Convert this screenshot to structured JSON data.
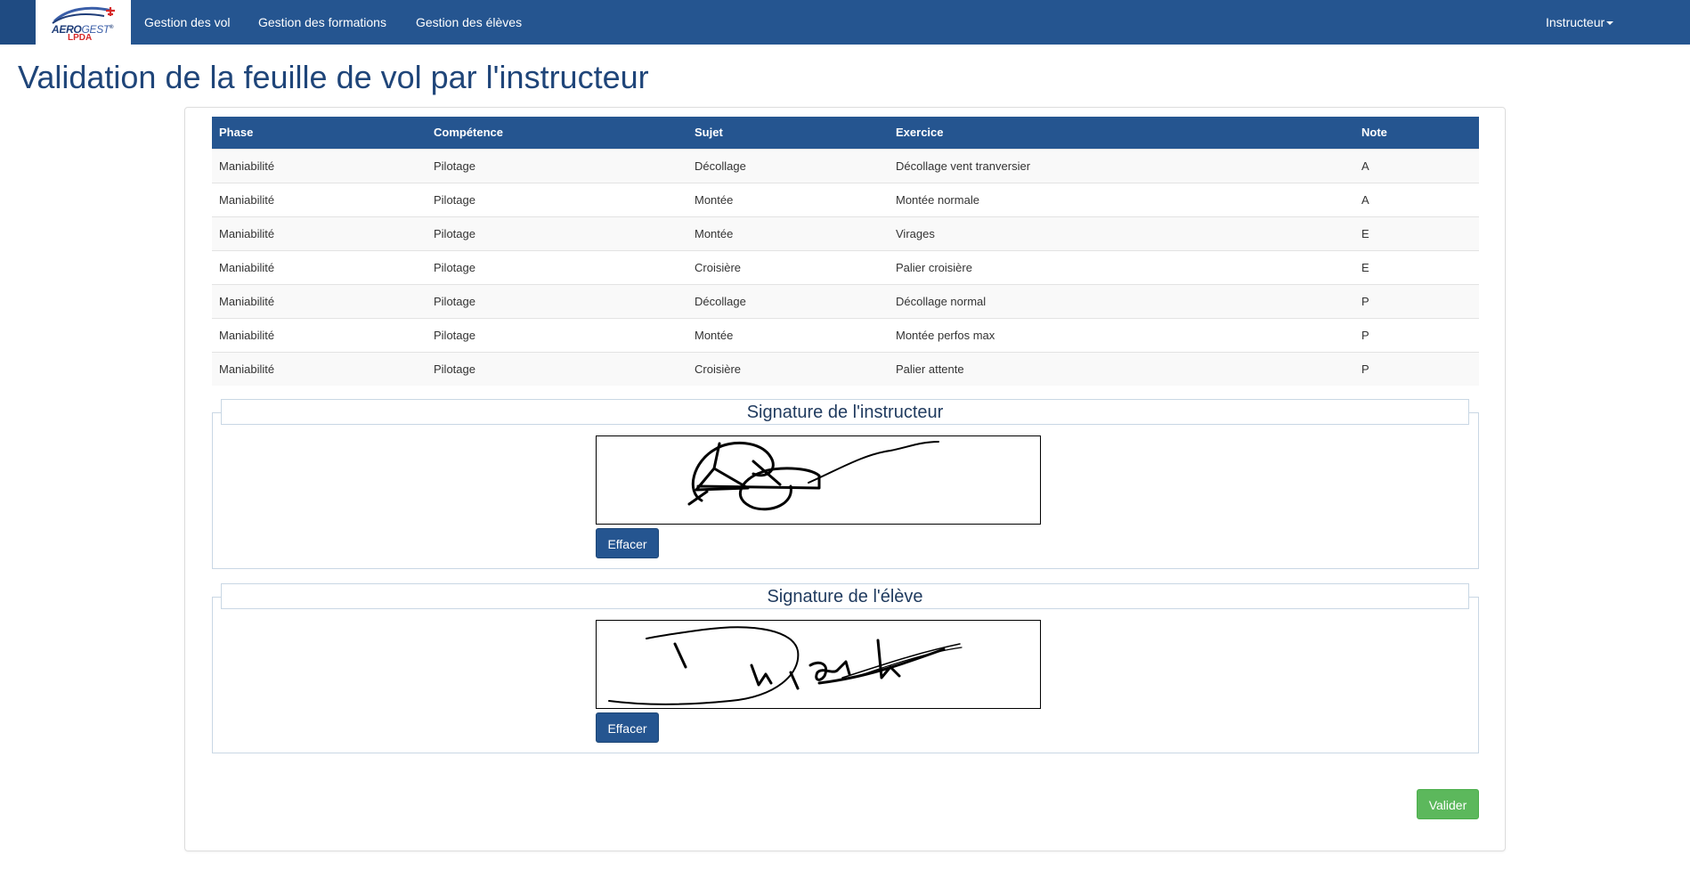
{
  "brand": {
    "aero": "AERO",
    "gest": "GEST",
    "reg": "®",
    "sub": "LPDA"
  },
  "nav": {
    "items": [
      {
        "label": "Gestion des vol"
      },
      {
        "label": "Gestion des formations"
      },
      {
        "label": "Gestion des élèves"
      }
    ],
    "user_menu": "Instructeur"
  },
  "page": {
    "title": "Validation de la feuille de vol par l'instructeur"
  },
  "table": {
    "headers": [
      "Phase",
      "Compétence",
      "Sujet",
      "Exercice",
      "Note"
    ],
    "rows": [
      [
        "Maniabilité",
        "Pilotage",
        "Décollage",
        "Décollage vent tranversier",
        "A"
      ],
      [
        "Maniabilité",
        "Pilotage",
        "Montée",
        "Montée normale",
        "A"
      ],
      [
        "Maniabilité",
        "Pilotage",
        "Montée",
        "Virages",
        "E"
      ],
      [
        "Maniabilité",
        "Pilotage",
        "Croisière",
        "Palier croisière",
        "E"
      ],
      [
        "Maniabilité",
        "Pilotage",
        "Décollage",
        "Décollage normal",
        "P"
      ],
      [
        "Maniabilité",
        "Pilotage",
        "Montée",
        "Montée perfos max",
        "P"
      ],
      [
        "Maniabilité",
        "Pilotage",
        "Croisière",
        "Palier attente",
        "P"
      ]
    ]
  },
  "signatures": [
    {
      "title": "Signature de l'instructeur",
      "clear_label": "Effacer"
    },
    {
      "title": "Signature de l'élève",
      "clear_label": "Effacer"
    }
  ],
  "actions": {
    "submit_label": "Valider"
  },
  "colors": {
    "navbar": "#255590",
    "primary": "#255590",
    "success": "#5cb85c",
    "title": "#1f4579"
  }
}
